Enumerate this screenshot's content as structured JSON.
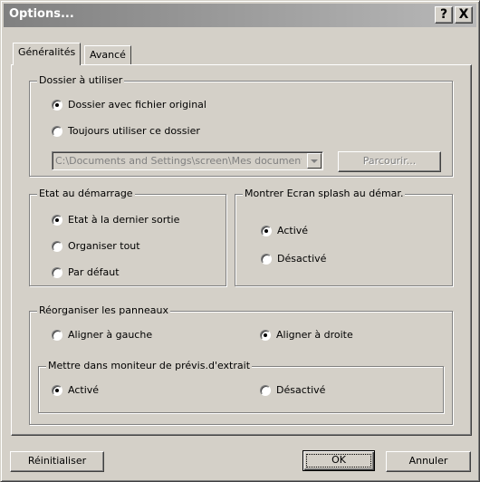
{
  "window": {
    "title": "Options..."
  },
  "titlebar_buttons": {
    "help": "?",
    "close": "X"
  },
  "tabs": [
    {
      "label": "Généralités",
      "active": true
    },
    {
      "label": "Avancé",
      "active": false
    }
  ],
  "dossier": {
    "title": "Dossier à utiliser",
    "option_original": "Dossier avec fichier original",
    "option_toujours": "Toujours utiliser ce dossier",
    "path_value": "C:\\Documents and Settings\\screen\\Mes documents",
    "browse_label": "Parcourir..."
  },
  "etat": {
    "title": "Etat au démarrage",
    "options": [
      "Etat à la dernier sortie",
      "Organiser tout",
      "Par défaut"
    ]
  },
  "splash": {
    "title": "Montrer Ecran splash au démar.",
    "options": [
      "Activé",
      "Désactivé"
    ]
  },
  "reorganiser": {
    "title": "Réorganiser les panneaux",
    "option_gauche": "Aligner à gauche",
    "option_droite": "Aligner à droite",
    "moniteur": {
      "title": "Mettre dans moniteur de prévis.d'extrait",
      "option_active": "Activé",
      "option_desactive": "Désactivé"
    }
  },
  "footer": {
    "reset_label": "Réinitialiser",
    "ok_label": "OK",
    "cancel_label": "Annuler"
  }
}
